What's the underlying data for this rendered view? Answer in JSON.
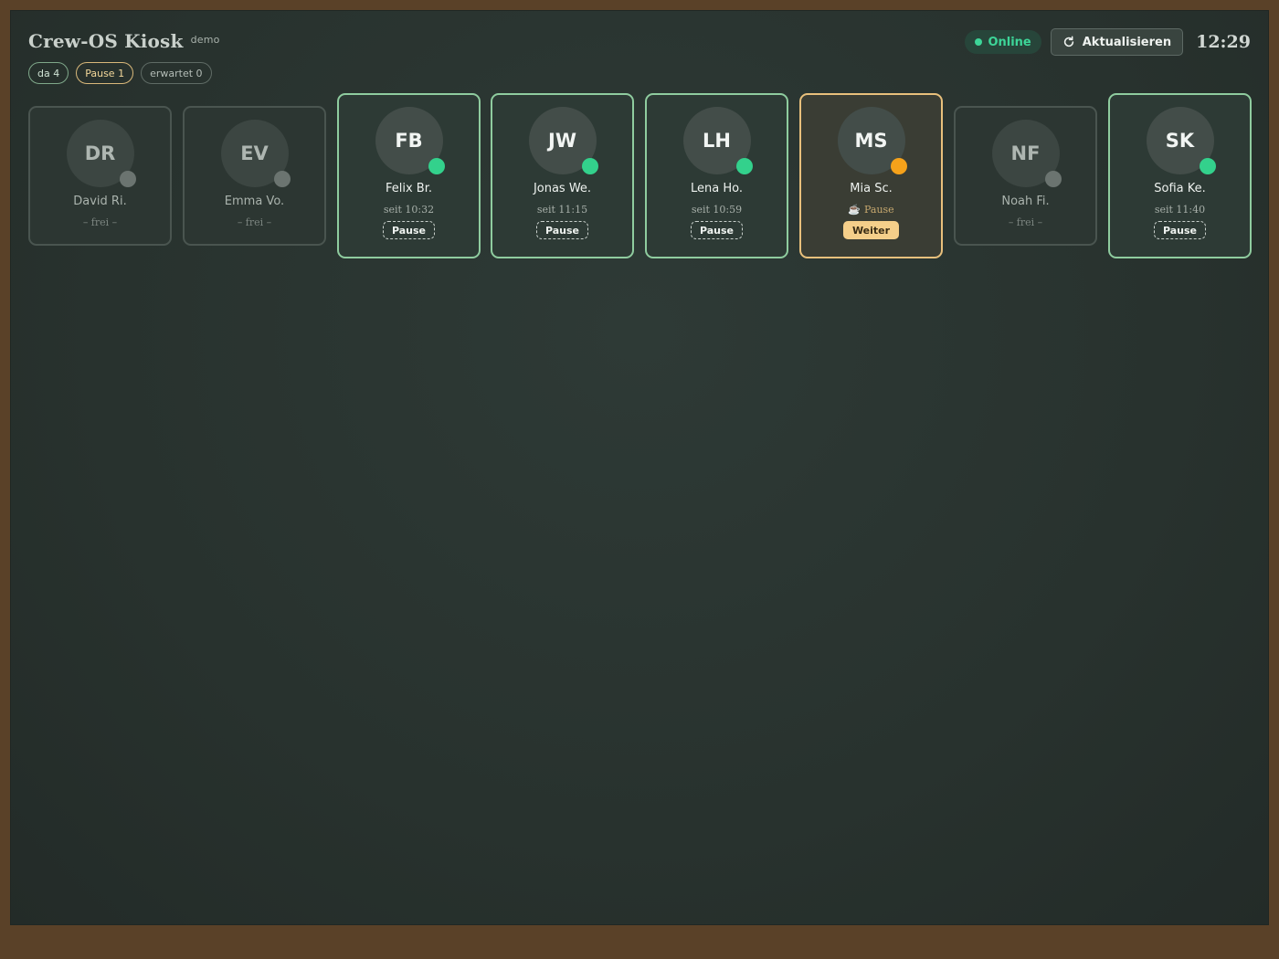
{
  "header": {
    "title": "Crew-OS Kiosk",
    "demo_label": "demo",
    "status": "Online",
    "refresh_label": "Aktualisieren",
    "clock": "12:29"
  },
  "chips": {
    "present": "da 4",
    "pause": "Pause 1",
    "expected": "erwartet 0"
  },
  "people": [
    {
      "initials": "DR",
      "name": "David Ri.",
      "state": "free",
      "info": "– frei –"
    },
    {
      "initials": "EV",
      "name": "Emma Vo.",
      "state": "free",
      "info": "– frei –"
    },
    {
      "initials": "FB",
      "name": "Felix Br.",
      "state": "active",
      "info": "seit 10:32",
      "action": "Pause"
    },
    {
      "initials": "JW",
      "name": "Jonas We.",
      "state": "active",
      "info": "seit 11:15",
      "action": "Pause"
    },
    {
      "initials": "LH",
      "name": "Lena Ho.",
      "state": "active",
      "info": "seit 10:59",
      "action": "Pause"
    },
    {
      "initials": "MS",
      "name": "Mia Sc.",
      "state": "break",
      "info": "Pause",
      "action": "Weiter"
    },
    {
      "initials": "NF",
      "name": "Noah Fi.",
      "state": "free",
      "info": "– frei –"
    },
    {
      "initials": "SK",
      "name": "Sofia Ke.",
      "state": "active",
      "info": "seit 11:40",
      "action": "Pause"
    }
  ],
  "colors": {
    "frame": "#5a4128",
    "board": "#28322e",
    "active_border": "#8fcc9f",
    "break_border": "#e8c07c",
    "online_green": "#3dd598",
    "break_orange": "#f6a21a"
  }
}
